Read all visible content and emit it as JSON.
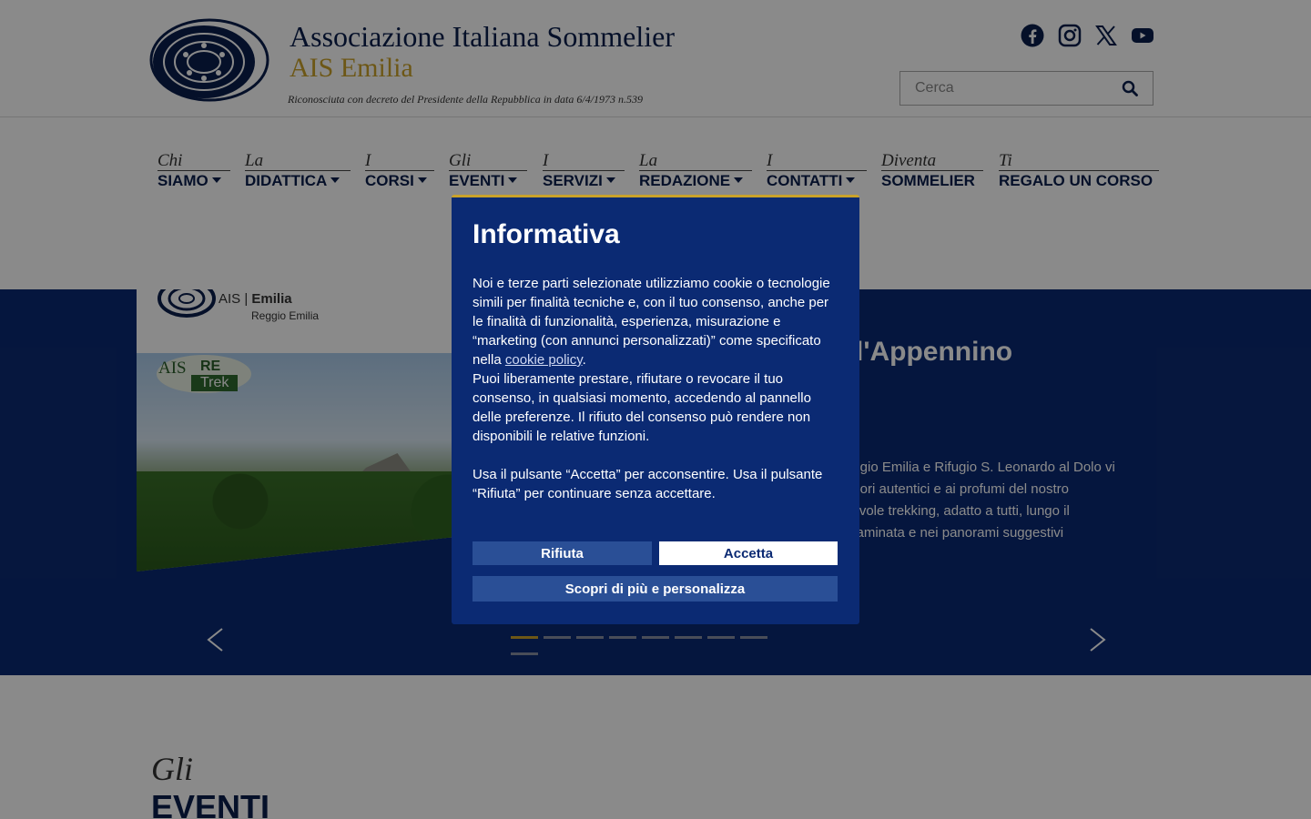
{
  "header": {
    "org_title": "Associazione Italiana Sommelier",
    "org_subtitle": "AIS Emilia",
    "tagline": "Riconosciuta con decreto del Presidente della Repubblica in data 6/4/1973 n.539",
    "social": [
      "facebook-icon",
      "instagram-icon",
      "x-icon",
      "youtube-icon"
    ],
    "search": {
      "placeholder": "Cerca",
      "value": ""
    }
  },
  "nav": {
    "items": [
      {
        "pre": "Chi",
        "main": "SIAMO",
        "dropdown": true
      },
      {
        "pre": "La",
        "main": "DIDATTICA",
        "dropdown": true
      },
      {
        "pre": "I",
        "main": "CORSI",
        "dropdown": true
      },
      {
        "pre": "Gli",
        "main": "EVENTI",
        "dropdown": true
      },
      {
        "pre": "I",
        "main": "SERVIZI",
        "dropdown": true
      },
      {
        "pre": "La",
        "main": "REDAZIONE",
        "dropdown": true
      },
      {
        "pre": "I",
        "main": "CONTATTI",
        "dropdown": true
      },
      {
        "pre": "Diventa",
        "main": "SOMMELIER",
        "dropdown": false
      },
      {
        "pre": "Ti",
        "main": "REGALO UN CORSO",
        "dropdown": false
      }
    ]
  },
  "hero": {
    "image_logo_brand": "AIS",
    "image_logo_region": "Emilia",
    "image_logo_city": "Reggio Emilia",
    "trek_badge": {
      "ais": "AIS",
      "re": "RE",
      "trek": "Trek"
    },
    "title_fragment": "l'Appennino",
    "text_fragments": [
      "eggio Emilia e Rifugio S. Leonardo al Dolo vi",
      "apori autentici e ai profumi del nostro",
      "cevole trekking, adatto a tutti, lungo il",
      "ntaminata e nei panorami suggestivi"
    ],
    "carousel": {
      "slides": 9,
      "active_index": 0
    }
  },
  "section": {
    "pre": "Gli",
    "main": "EVENTI"
  },
  "modal": {
    "title": "Informativa",
    "paragraph1_a": "Noi e terze parti selezionate utilizziamo cookie o tecnologie simili per finalità tecniche e, con il tuo consenso, anche per le finalità di funzionalità, esperienza, misurazione e “marketing (con annunci personalizzati)” come specificato nella ",
    "cookie_link": "cookie policy",
    "paragraph1_b": ".",
    "paragraph1_c": "Puoi liberamente prestare, rifiutare o revocare il tuo consenso, in qualsiasi momento, accedendo al pannello delle preferenze. Il rifiuto del consenso può rendere non disponibili le relative funzioni.",
    "paragraph2": "Usa il pulsante “Accetta” per acconsentire. Usa il pulsante “Rifiuta” per continuare senza accettare.",
    "reject_label": "Rifiuta",
    "accept_label": "Accetta",
    "more_label": "Scopri di più e personalizza"
  },
  "colors": {
    "navy": "#0b2a73",
    "gold": "#c9a22a",
    "text_dark": "#0b1f4d"
  }
}
